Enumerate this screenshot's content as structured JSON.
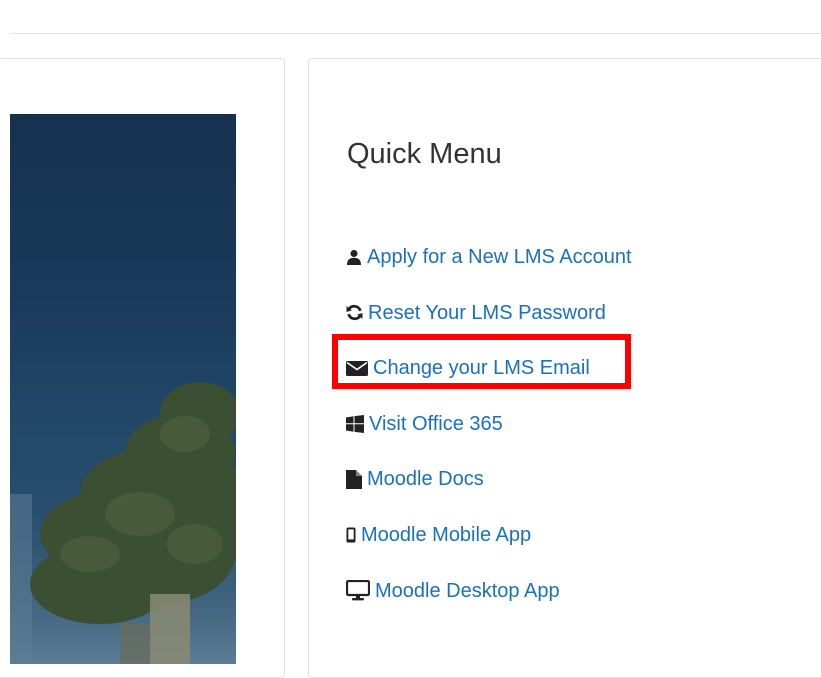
{
  "quick_menu": {
    "title": "Quick Menu",
    "items": [
      {
        "label": "Apply for a New LMS Account",
        "icon": "user-icon"
      },
      {
        "label": "Reset Your LMS Password",
        "icon": "refresh-icon"
      },
      {
        "label": "Change your LMS Email",
        "icon": "envelope-icon"
      },
      {
        "label": "Visit Office 365",
        "icon": "windows-icon"
      },
      {
        "label": "Moodle Docs",
        "icon": "document-icon"
      },
      {
        "label": "Moodle Mobile App",
        "icon": "mobile-phone-icon"
      },
      {
        "label": "Moodle Desktop App",
        "icon": "desktop-icon"
      }
    ]
  },
  "colors": {
    "link": "#1a6fc0",
    "highlight": "#ff0000",
    "border": "#e2e2e2",
    "title": "#333333"
  }
}
